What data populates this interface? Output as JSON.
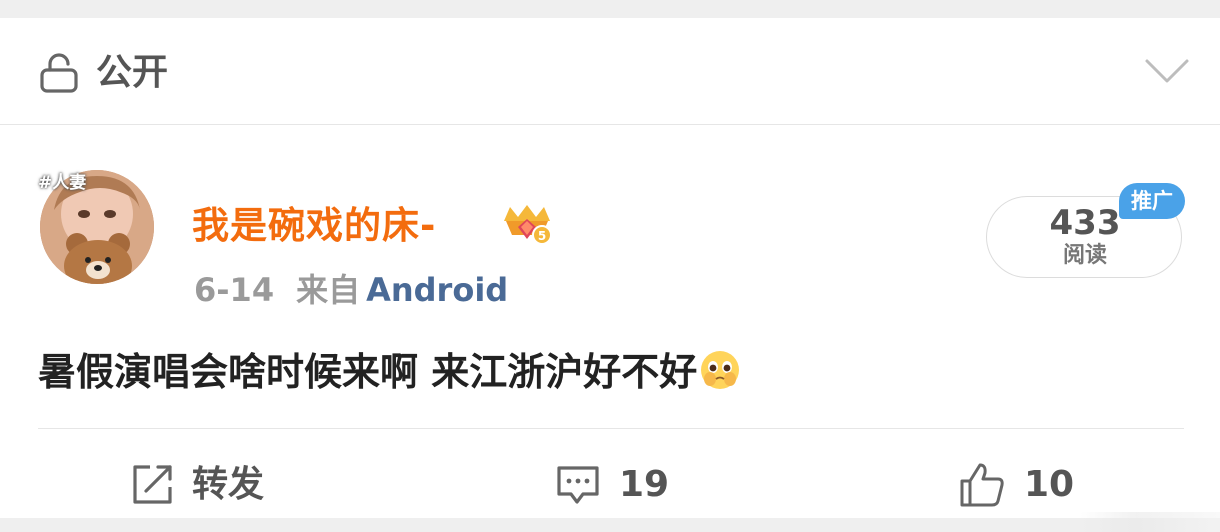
{
  "privacy": {
    "label": "公开",
    "icon": "lock-open-icon",
    "toggle_icon": "chevron-down-icon"
  },
  "post": {
    "author": {
      "avatar_tag": "#人妻",
      "name": "我是碗戏的床-",
      "badge_icon": "vip-level-badge-icon"
    },
    "date": "6-14",
    "source_prefix": "来自",
    "source": "Android",
    "reads": {
      "count": "433",
      "label": "阅读",
      "promo_badge": "推广"
    },
    "text": "暑假演唱会啥时候来啊 来江浙沪好不好",
    "emoji_icon": "pleading-face-emoji-icon"
  },
  "actions": {
    "forward": {
      "icon": "share-edit-icon",
      "label": "转发"
    },
    "comment": {
      "icon": "comment-icon",
      "label": "19"
    },
    "like": {
      "icon": "thumbs-up-icon",
      "label": "10"
    }
  },
  "colors": {
    "username": "#f36c0e",
    "source_link": "#4a6a96",
    "promo_badge": "#4aa2e8",
    "background": "#efefef"
  }
}
